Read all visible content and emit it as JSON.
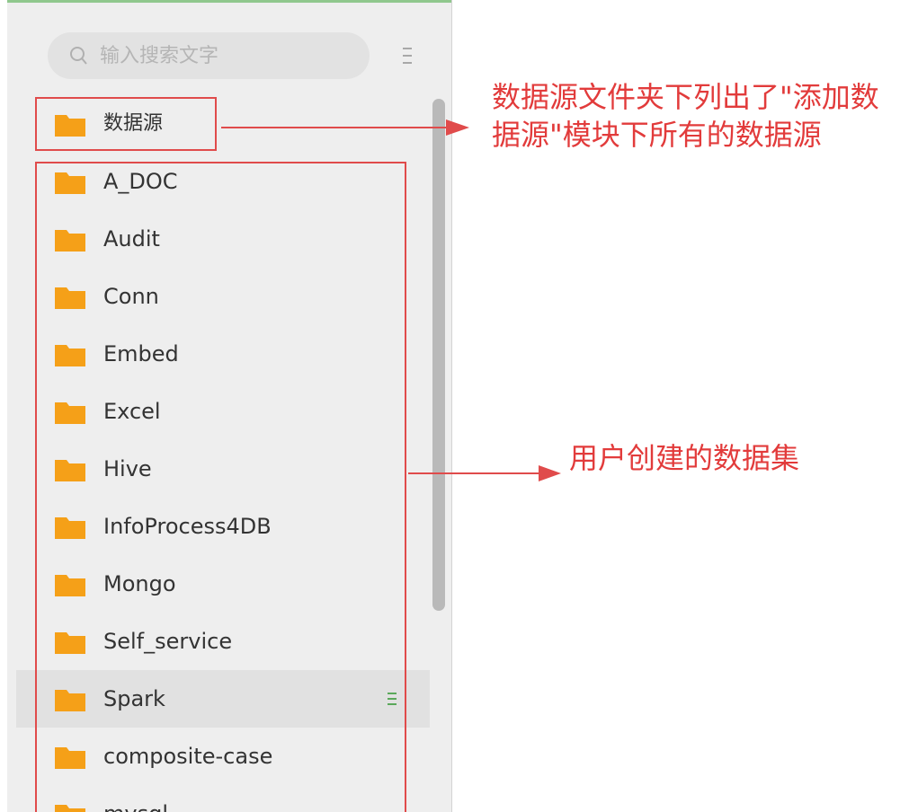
{
  "search": {
    "placeholder": "输入搜索文字"
  },
  "datasource_folder": {
    "label": "数据源"
  },
  "folders": [
    {
      "label": "A_DOC"
    },
    {
      "label": "Audit"
    },
    {
      "label": "Conn"
    },
    {
      "label": "Embed"
    },
    {
      "label": "Excel"
    },
    {
      "label": "Hive"
    },
    {
      "label": "InfoProcess4DB"
    },
    {
      "label": "Mongo"
    },
    {
      "label": "Self_service"
    },
    {
      "label": "Spark",
      "selected": true
    },
    {
      "label": "composite-case"
    },
    {
      "label": "mysql"
    }
  ],
  "annotations": {
    "datasource_note": [
      "数据源文件夹下列出了\"添加数",
      "据源\"模块下所有的数据源"
    ],
    "datasets_note": "用户创建的数据集"
  },
  "colors": {
    "folder": "#f5a018",
    "annotation": "#e23b3b",
    "panel_bg": "#eeeeee",
    "selected_row": "#e1e1e1",
    "row_menu": "#5aa85a"
  }
}
